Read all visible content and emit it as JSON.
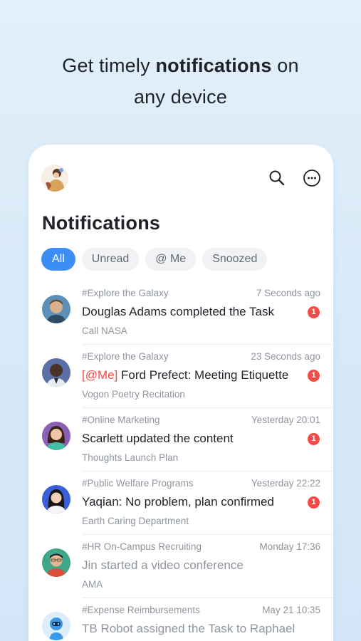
{
  "headline": {
    "pre": "Get timely ",
    "bold": "notifications",
    "post": " on",
    "line2": "any device"
  },
  "screen": {
    "title": "Notifications",
    "tabs": [
      {
        "label": "All",
        "active": true
      },
      {
        "label": "Unread",
        "active": false
      },
      {
        "label": "@ Me",
        "active": false
      },
      {
        "label": "Snoozed",
        "active": false
      }
    ]
  },
  "notifications": [
    {
      "group": "#Explore the Galaxy",
      "time": "7 Seconds ago",
      "mention": "",
      "message": "Douglas Adams completed the Task",
      "subtitle": "Call NASA",
      "badge": "1",
      "read": false,
      "avatar": "avatar-douglas"
    },
    {
      "group": "#Explore the Galaxy",
      "time": "23 Seconds ago",
      "mention": "[@Me]",
      "message": " Ford Prefect: Meeting Etiquette",
      "subtitle": "Vogon Poetry Recitation",
      "badge": "1",
      "read": false,
      "avatar": "avatar-ford"
    },
    {
      "group": "#Online Marketing",
      "time": "Yesterday 20:01",
      "mention": "",
      "message": "Scarlett updated the content",
      "subtitle": "Thoughts Launch Plan",
      "badge": "1",
      "read": false,
      "avatar": "avatar-scarlett"
    },
    {
      "group": "#Public Welfare Programs",
      "time": "Yesterday 22:22",
      "mention": "",
      "message": "Yaqian: No problem, plan confirmed",
      "subtitle": "Earth Caring Department",
      "badge": "1",
      "read": false,
      "avatar": "avatar-yaqian"
    },
    {
      "group": "#HR On-Campus Recruiting",
      "time": "Monday 17:36",
      "mention": "",
      "message": "Jin started a video conference",
      "subtitle": "AMA",
      "badge": "",
      "read": true,
      "avatar": "avatar-jin"
    },
    {
      "group": "#Expense Reimbursements",
      "time": "May 21 10:35",
      "mention": "",
      "message": "TB Robot assigned the Task to Raphael",
      "subtitle": "",
      "badge": "",
      "read": true,
      "avatar": "robot-avatar"
    }
  ],
  "colors": {
    "accent": "#3c8ef5",
    "badge": "#f54a45",
    "mention": "#f54a45"
  }
}
